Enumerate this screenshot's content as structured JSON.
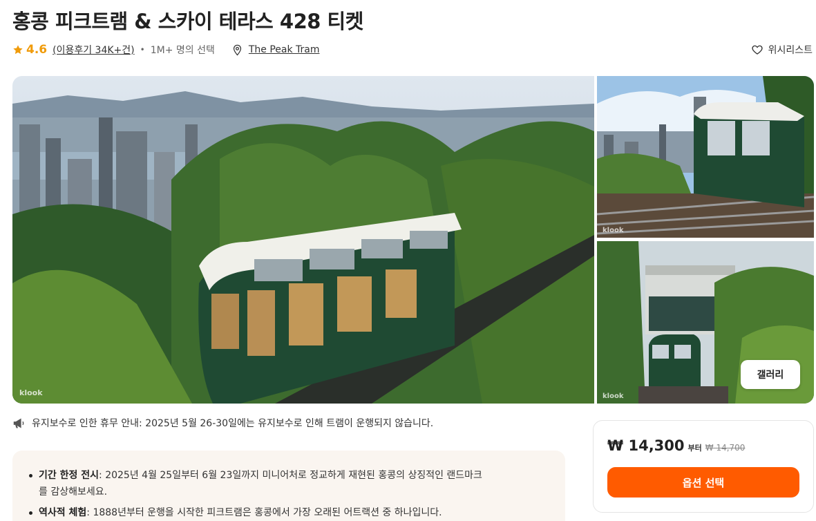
{
  "product": {
    "title": "홍콩 피크트램 & 스카이 테라스 428 티켓",
    "rating": "4.6",
    "reviews": "(이용후기 34K+건)",
    "booked": "1M+ 명의 선택",
    "location": "The Peak Tram"
  },
  "wishlist": {
    "label": "위시리스트"
  },
  "gallery": {
    "button_label": "갤러리",
    "watermark": "klook"
  },
  "notice": {
    "text": "유지보수로 인한 휴무 안내: 2025년 5월 26-30일에는 유지보수로 인해 트램이 운행되지 않습니다."
  },
  "highlights": [
    {
      "label": "기간 한정 전시",
      "text": ": 2025년 4월 25일부터 6월 23일까지 미니어처로 정교하게 재현된 홍콩의 상징적인 랜드마크를 감상해보세요."
    },
    {
      "label": "역사적 체험",
      "text": ": 1888년부터 운행을 시작한 피크트램은 홍콩에서 가장 오래된 어트랙션 중 하나입니다."
    }
  ],
  "pricing": {
    "price": "₩ 14,300",
    "from": "부터",
    "original": "₩ 14,700",
    "button_label": "옵션 선택"
  },
  "colors": {
    "accent": "#ff5b00",
    "rating": "#f09b0a",
    "tram_green": "#1f4a33"
  },
  "icons": [
    "star-icon",
    "location-pin-icon",
    "heart-icon",
    "megaphone-icon"
  ]
}
